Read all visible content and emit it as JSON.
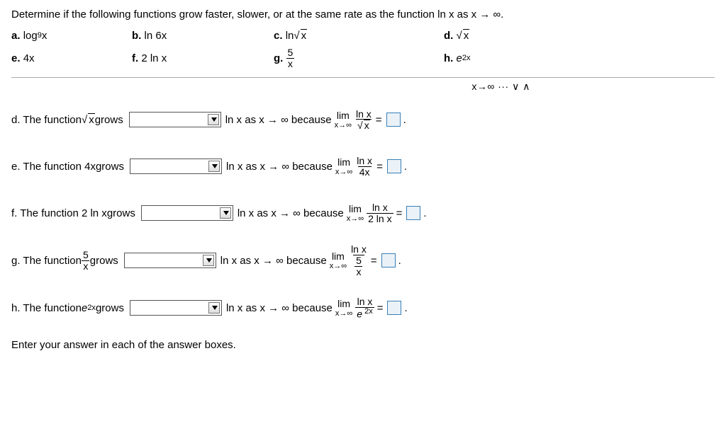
{
  "instructions": "Determine if the following functions grow faster, slower, or at the same rate as the function ln x as x → ∞.",
  "options": {
    "a": {
      "label": "a.",
      "text": "log ",
      "sub": "9",
      "after": "x"
    },
    "b": {
      "label": "b.",
      "text": "ln 6x"
    },
    "c": {
      "label": "c.",
      "text": "ln ",
      "sqrt": "x"
    },
    "d": {
      "label": "d.",
      "sqrt": "x"
    },
    "e": {
      "label": "e.",
      "text": "4x"
    },
    "f": {
      "label": "f.",
      "text": "2 ln x"
    },
    "g": {
      "label": "g.",
      "num": "5",
      "den": "x"
    },
    "h": {
      "label": "h.",
      "ital": "e",
      "sup": " 2x"
    }
  },
  "truncated": "x→∞ ··· ∨ ∧",
  "common": {
    "grows": " grows",
    "lnxas": " ln x as x → ∞ because ",
    "lim": "lim",
    "limsub": "x→∞",
    "lnx": "ln x",
    "equals": "="
  },
  "questions": {
    "d": {
      "prefix": "d. The function ",
      "func_sqrt": "x",
      "den_sqrt": "x"
    },
    "e": {
      "prefix": "e. The function 4x",
      "den": "4x"
    },
    "f": {
      "prefix": "f. The function 2 ln x",
      "den": "2 ln x"
    },
    "g": {
      "prefix": "g. The function ",
      "num": "5",
      "den": "x",
      "limden_num": "5",
      "limden_den": "x"
    },
    "h": {
      "prefix": "h. The function ",
      "ital": "e",
      "sup": " 2x",
      "limden_ital": "e",
      "limden_sup": " 2x"
    }
  },
  "footer": "Enter your answer in each of the answer boxes."
}
